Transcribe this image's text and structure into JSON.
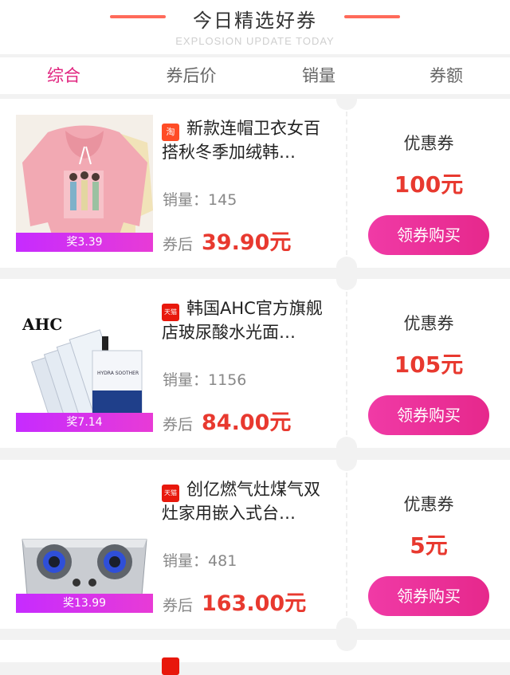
{
  "header": {
    "title": "今日精选好券",
    "subtitle": "EXPLOSION UPDATE TODAY"
  },
  "tabs": [
    {
      "label": "综合",
      "active": true
    },
    {
      "label": "券后价",
      "active": false
    },
    {
      "label": "销量",
      "active": false
    },
    {
      "label": "券额",
      "active": false
    }
  ],
  "products": [
    {
      "platform_icon": "淘",
      "name": "新款连帽卫衣女百搭秋冬季加绒韩…",
      "sales_label": "销量：",
      "sales": "145",
      "price_label": "券后",
      "price": "39.90元",
      "reward": "奖3.39",
      "coupon_title": "优惠券",
      "coupon_value": "100元",
      "button": "领券购买"
    },
    {
      "platform_icon": "天猫",
      "name": "韩国AHC官方旗舰店玻尿酸水光面…",
      "sales_label": "销量：",
      "sales": "1156",
      "price_label": "券后",
      "price": "84.00元",
      "reward": "奖7.14",
      "coupon_title": "优惠券",
      "coupon_value": "105元",
      "button": "领券购买",
      "image_text": "AHC"
    },
    {
      "platform_icon": "天猫",
      "name": "创亿燃气灶煤气双灶家用嵌入式台…",
      "sales_label": "销量：",
      "sales": "481",
      "price_label": "券后",
      "price": "163.00元",
      "reward": "奖13.99",
      "coupon_title": "优惠券",
      "coupon_value": "5元",
      "button": "领券购买"
    }
  ],
  "colors": {
    "accent_pink": "#e0237e",
    "price_red": "#e8392f",
    "reward_purple": "#c62bff"
  }
}
